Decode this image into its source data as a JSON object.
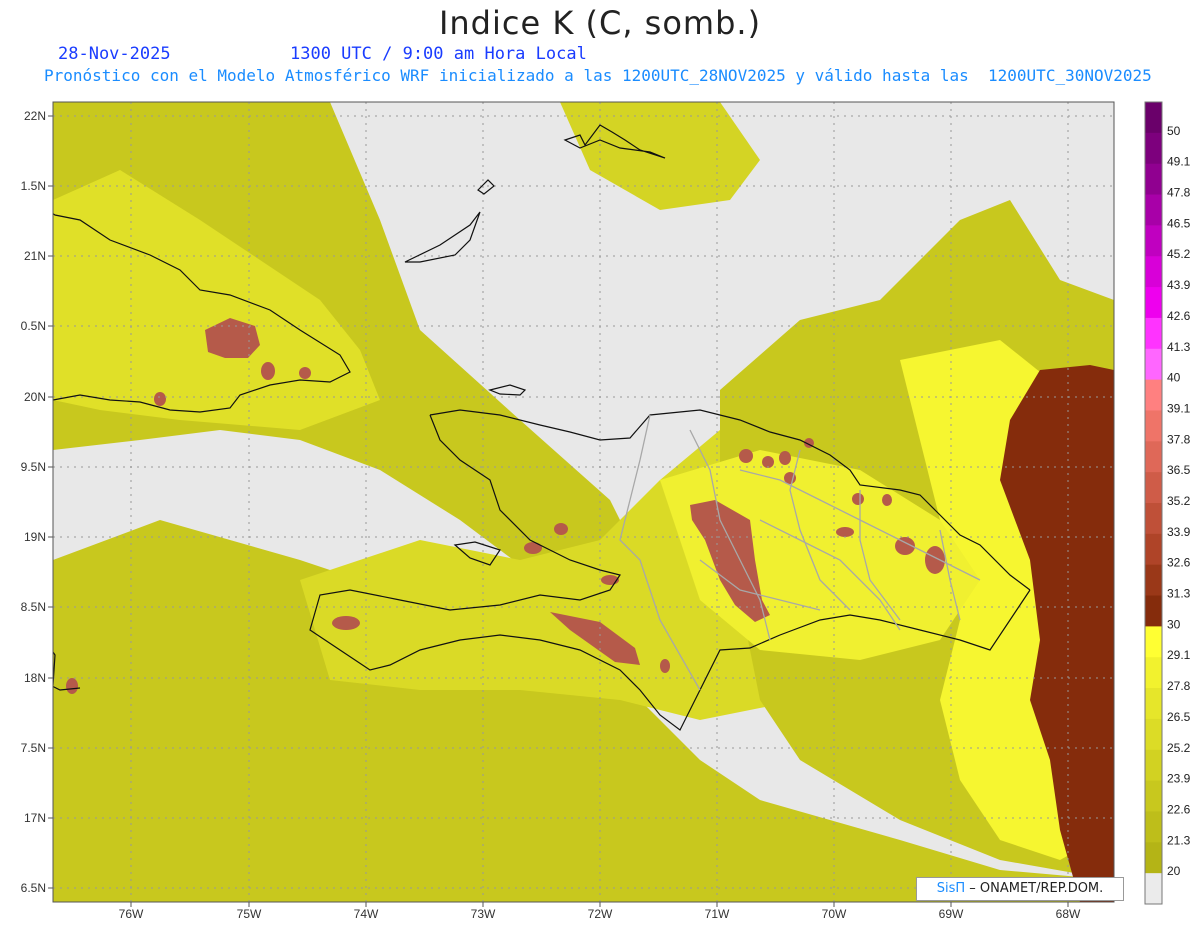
{
  "header": {
    "title": "Indice K (C, somb.)",
    "date": "28-Nov-2025",
    "time": "1300 UTC / 9:00 am Hora Local",
    "subtitle": "Pronóstico con el Modelo Atmosférico WRF inicializado a las 1200UTC_28NOV2025 y válido hasta las  1200UTC_30NOV2025"
  },
  "axes": {
    "lon_labels": [
      "76W",
      "75W",
      "74W",
      "73W",
      "72W",
      "71W",
      "70W",
      "69W",
      "68W"
    ],
    "lat_labels": [
      "22N",
      "1.5N",
      "21N",
      "0.5N",
      "20N",
      "9.5N",
      "19N",
      "8.5N",
      "18N",
      "7.5N",
      "17N",
      "6.5N"
    ]
  },
  "colorbar": {
    "labels": [
      "50",
      "49.1",
      "47.8",
      "46.5",
      "45.2",
      "43.9",
      "42.6",
      "41.3",
      "40",
      "39.1",
      "37.8",
      "36.5",
      "35.2",
      "33.9",
      "32.6",
      "31.3",
      "30",
      "29.1",
      "27.8",
      "26.5",
      "25.2",
      "23.9",
      "22.6",
      "21.3",
      "20"
    ],
    "colors": [
      "#6a006a",
      "#7d007d",
      "#900090",
      "#a800a8",
      "#c000c0",
      "#d800d8",
      "#ee00ee",
      "#ff33ff",
      "#ff66ff",
      "#ff8080",
      "#ef7468",
      "#df6858",
      "#cf5c48",
      "#bf5038",
      "#af4428",
      "#9a3818",
      "#852c0c",
      "#ffff33",
      "#f2f22e",
      "#e6e62a",
      "#dcdc26",
      "#d2d222",
      "#c8c81e",
      "#bebe1a",
      "#b4b416",
      "#ebebeb"
    ]
  },
  "credit": {
    "brand": "SisΠ",
    "org": "– ONAMET/REP.DOM."
  }
}
